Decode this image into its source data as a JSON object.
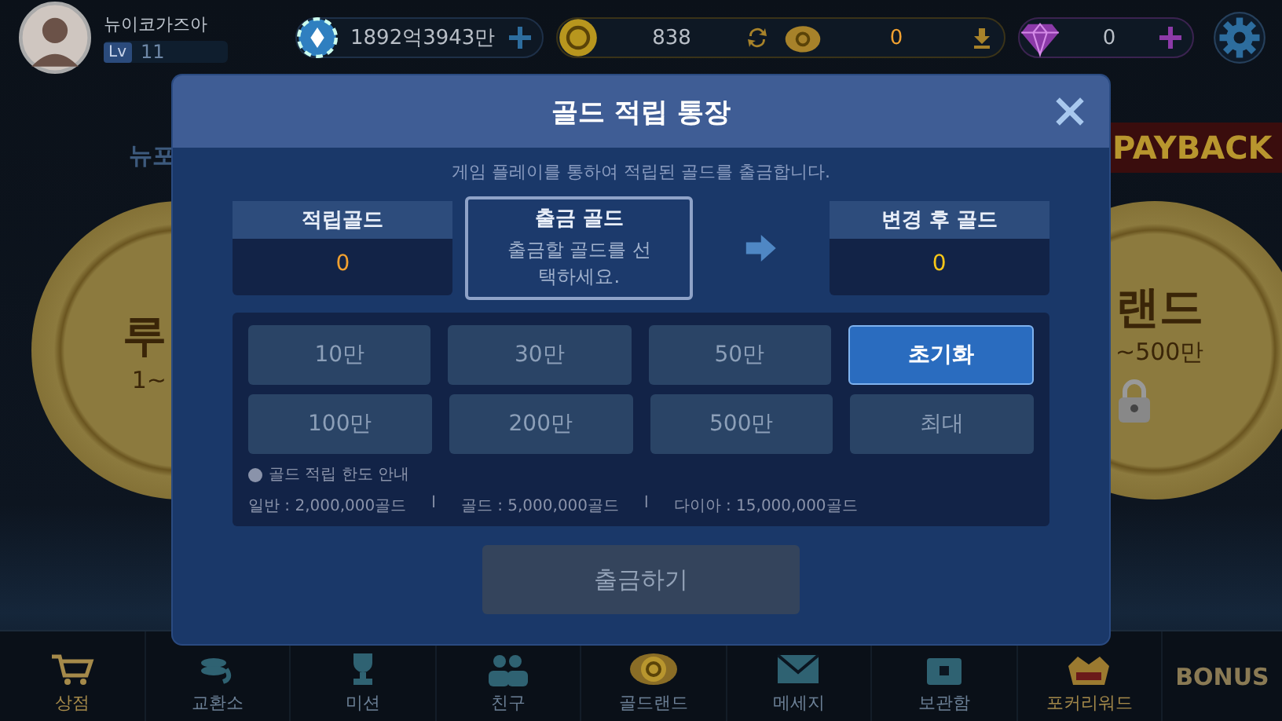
{
  "profile": {
    "name": "뉴이코가즈아",
    "level_badge": "Lv",
    "level": "11"
  },
  "currencies": {
    "chips": "1892억3943만",
    "gold": "838",
    "saved_gold": "0",
    "diamonds": "0"
  },
  "background": {
    "tab_text": "뉴포",
    "left_chip": {
      "title": "루",
      "range": "1~"
    },
    "right_chip": {
      "title": "랜드",
      "range": "~500만",
      "locked": true
    },
    "banner": "PAYBACK"
  },
  "dialog": {
    "title": "골드 적립 통장",
    "subtitle": "게임 플레이를 통하여 적립된 골드를 출금합니다.",
    "boxes": [
      {
        "label": "적립골드",
        "value": "0",
        "kind": "accumulated",
        "selected": false
      },
      {
        "label": "출금 골드",
        "value": "출금할 골드를 선택하세요.",
        "kind": "withdraw",
        "selected": true
      },
      {
        "label": "변경 후 골드",
        "value": "0",
        "kind": "result",
        "selected": false
      }
    ],
    "amounts": [
      {
        "label": "10만",
        "kind": "amount"
      },
      {
        "label": "30만",
        "kind": "amount"
      },
      {
        "label": "50만",
        "kind": "amount"
      },
      {
        "label": "초기화",
        "kind": "reset"
      },
      {
        "label": "100만",
        "kind": "amount"
      },
      {
        "label": "200만",
        "kind": "amount"
      },
      {
        "label": "500만",
        "kind": "amount"
      },
      {
        "label": "최대",
        "kind": "amount"
      }
    ],
    "limit_title": "골드 적립 한도 안내",
    "limits": [
      "일반 : 2,000,000골드",
      "골드 : 5,000,000골드",
      "다이아 : 15,000,000골드"
    ],
    "separators": [
      "l",
      "l"
    ],
    "submit": {
      "label": "출금하기",
      "disabled": true
    }
  },
  "nav": [
    {
      "label": "상점",
      "kind": "cart",
      "highlighted": true
    },
    {
      "label": "교환소",
      "kind": "exchange",
      "highlighted": false
    },
    {
      "label": "미션",
      "kind": "trophy",
      "highlighted": false
    },
    {
      "label": "친구",
      "kind": "friends",
      "highlighted": false
    },
    {
      "label": "골드랜드",
      "kind": "coin",
      "highlighted": false
    },
    {
      "label": "메세지",
      "kind": "mail",
      "highlighted": false
    },
    {
      "label": "보관함",
      "kind": "chest",
      "highlighted": false
    },
    {
      "label": "포커리워드",
      "kind": "vip",
      "highlighted": true
    }
  ],
  "bonus": "BONUS"
}
